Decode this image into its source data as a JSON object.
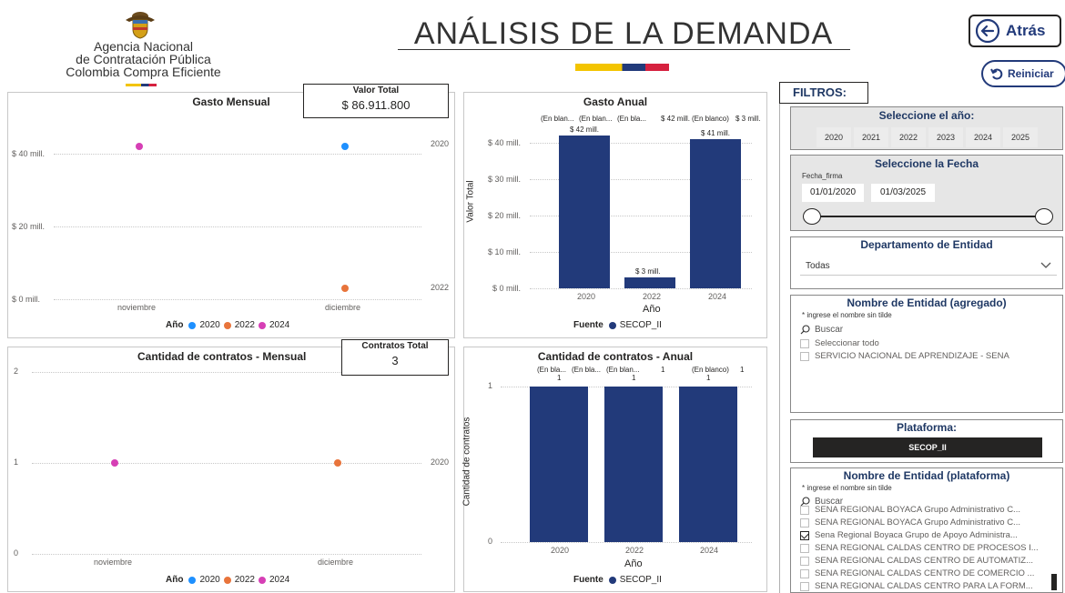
{
  "header": {
    "org_line1": "Agencia Nacional",
    "org_line2": "de Contratación Pública",
    "org_line3": "Colombia Compra Eficiente",
    "page_title": "ANÁLISIS DE LA DEMANDA",
    "back_label": "Atrás",
    "reset_label": "Reiniciar",
    "filters_label": "FILTROS:"
  },
  "colors": {
    "navy": "#223a7a",
    "series_2020": "#1e90ff",
    "series_2022": "#e8743b",
    "series_2024": "#d63fb5",
    "flag_yellow": "#f3c400",
    "flag_blue": "#223a7a",
    "flag_red": "#d6213f"
  },
  "gasto_mensual": {
    "title": "Gasto Mensual",
    "kpi_title": "Valor Total",
    "kpi_value": "$ 86.911.800",
    "right_labels": [
      "2020",
      "2022"
    ],
    "legend_title": "Año",
    "legend_items": [
      "2020",
      "2022",
      "2024"
    ]
  },
  "gasto_anual": {
    "title": "Gasto Anual",
    "top_labels": [
      "(En blan...",
      "(En blan...",
      "(En bla...",
      "$ 42 mill.",
      "(En blanco)",
      "$ 3 mill."
    ],
    "ylabel": "Valor Total",
    "xlabel": "Año",
    "legend_title": "Fuente",
    "legend_item": "SECOP_II"
  },
  "cantidad_mensual": {
    "title": "Cantidad de contratos - Mensual",
    "kpi_title": "Contratos Total",
    "kpi_value": "3",
    "right_label": "2020",
    "legend_title": "Año",
    "legend_items": [
      "2020",
      "2022",
      "2024"
    ]
  },
  "cantidad_anual": {
    "title": "Cantidad de contratos - Anual",
    "top_labels": [
      "(En bla...",
      "(En bla...",
      "(En blan...",
      "1",
      "(En blanco)",
      "1"
    ],
    "top_values": [
      "1",
      "1",
      "1"
    ],
    "ylabel": "Cantidad de contratos",
    "xlabel": "Año",
    "legend_title": "Fuente",
    "legend_item": "SECOP_II"
  },
  "filters": {
    "year_title": "Seleccione el año:",
    "years": [
      "2020",
      "2021",
      "2022",
      "2023",
      "2024",
      "2025"
    ],
    "date_title": "Seleccione la Fecha",
    "date_field": "Fecha_firma",
    "date_from": "01/01/2020",
    "date_to": "01/03/2025",
    "slider_range": [
      0,
      1
    ],
    "dept_title": "Departamento de Entidad",
    "dept_value": "Todas",
    "entidad_title": "Nombre de Entidad (agregado)",
    "entidad_hint": "* ingrese el nombre sin tilde",
    "search_placeholder": "Buscar",
    "entidad_items": [
      "Seleccionar todo",
      "SERVICIO NACIONAL DE APRENDIZAJE - SENA"
    ],
    "plataforma_title": "Plataforma:",
    "plataforma_value": "SECOP_II",
    "entidad_plat_title": "Nombre de Entidad (plataforma)",
    "entidad_plat_hint": "* ingrese el nombre sin tilde",
    "entidad_plat_items": [
      {
        "label": "SENA REGIONAL BOYACA Grupo Administrativo C...",
        "checked": false
      },
      {
        "label": "SENA REGIONAL BOYACA Grupo Administrativo C...",
        "checked": false
      },
      {
        "label": "Sena Regional Boyaca Grupo de Apoyo Administra...",
        "checked": true
      },
      {
        "label": "SENA REGIONAL CALDAS CENTRO DE PROCESOS I...",
        "checked": false
      },
      {
        "label": "SENA REGIONAL CALDAS CENTRO DE AUTOMATIZ...",
        "checked": false
      },
      {
        "label": "SENA REGIONAL CALDAS CENTRO DE COMERCIO ...",
        "checked": false
      },
      {
        "label": "SENA REGIONAL CALDAS CENTRO PARA LA FORM...",
        "checked": false
      }
    ]
  },
  "chart_data": [
    {
      "type": "scatter",
      "title": "Gasto Mensual",
      "categories": [
        "noviembre",
        "diciembre"
      ],
      "yticks": [
        "$ 0 mill.",
        "$ 20 mill.",
        "$ 40 mill."
      ],
      "ylim": [
        0,
        50
      ],
      "series": [
        {
          "name": "2020",
          "points": [
            {
              "x": "diciembre",
              "y": 42
            }
          ]
        },
        {
          "name": "2022",
          "points": [
            {
              "x": "diciembre",
              "y": 3
            }
          ]
        },
        {
          "name": "2024",
          "points": [
            {
              "x": "noviembre",
              "y": 42
            }
          ]
        }
      ]
    },
    {
      "type": "bar",
      "title": "Gasto Anual",
      "categories": [
        "2020",
        "2022",
        "2024"
      ],
      "values": [
        42,
        3,
        41
      ],
      "value_labels": [
        "$ 42 mill.",
        "$ 3 mill.",
        "$ 41 mill."
      ],
      "yticks": [
        "$ 0 mill.",
        "$ 10 mill.",
        "$ 20 mill.",
        "$ 30 mill.",
        "$ 40 mill."
      ],
      "ylim": [
        0,
        46
      ],
      "xlabel": "Año",
      "ylabel": "Valor Total"
    },
    {
      "type": "scatter",
      "title": "Cantidad de contratos - Mensual",
      "categories": [
        "noviembre",
        "diciembre"
      ],
      "yticks": [
        "0",
        "1",
        "2"
      ],
      "ylim": [
        0,
        2
      ],
      "series": [
        {
          "name": "2024",
          "points": [
            {
              "x": "noviembre",
              "y": 1
            }
          ]
        },
        {
          "name": "2022",
          "points": [
            {
              "x": "diciembre",
              "y": 1
            }
          ]
        }
      ]
    },
    {
      "type": "bar",
      "title": "Cantidad de contratos - Anual",
      "categories": [
        "2020",
        "2022",
        "2024"
      ],
      "values": [
        1,
        1,
        1
      ],
      "yticks": [
        "0",
        "1"
      ],
      "ylim": [
        0,
        1
      ],
      "xlabel": "Año",
      "ylabel": "Cantidad de contratos"
    }
  ]
}
